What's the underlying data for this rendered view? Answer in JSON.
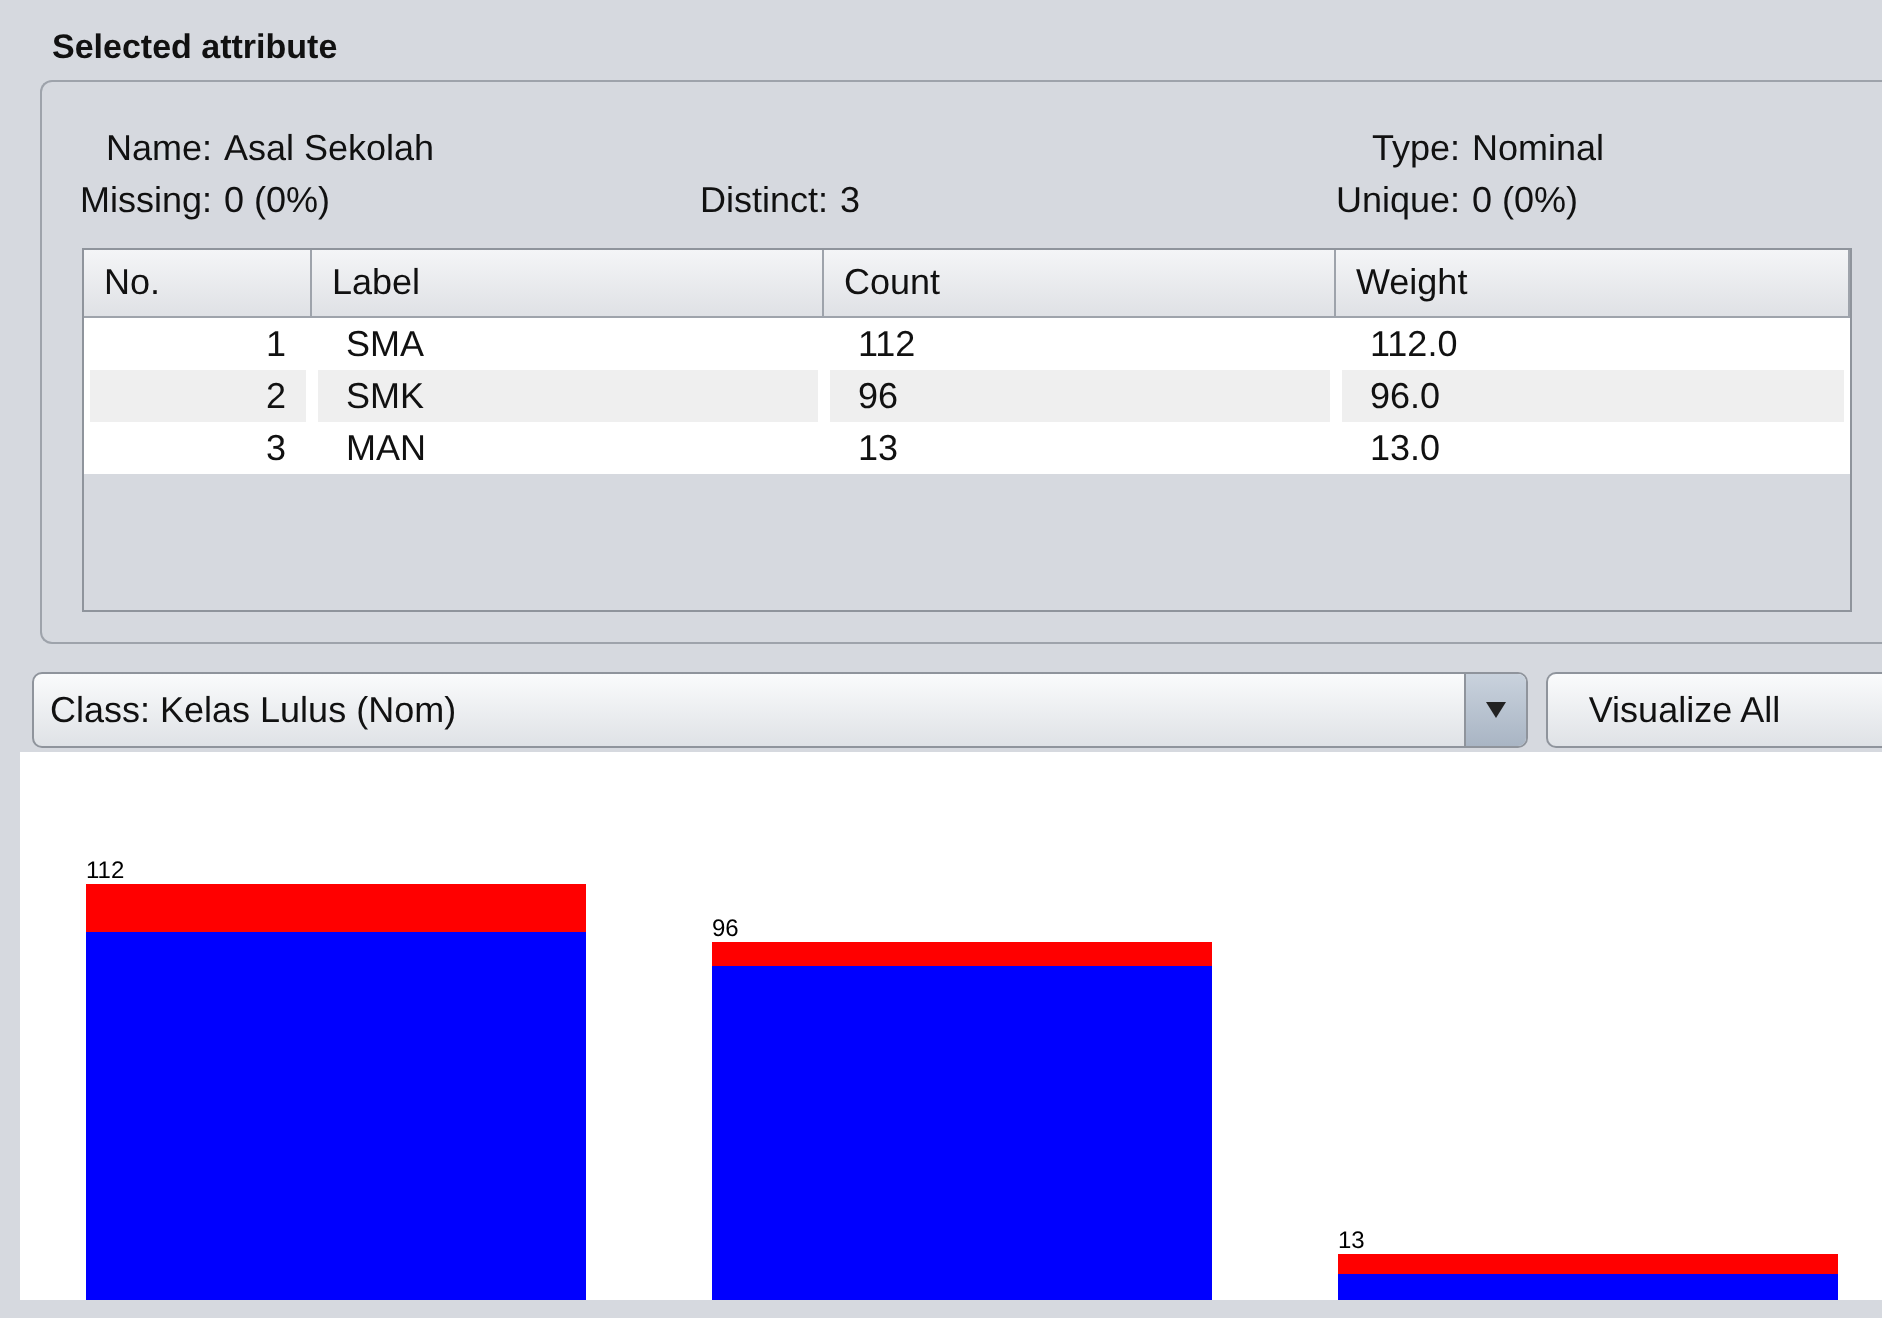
{
  "panel": {
    "title": "Selected attribute",
    "info": [
      {
        "label": "Name:",
        "value": "Asal Sekolah"
      },
      {
        "label": "Type:",
        "value": "Nominal"
      },
      {
        "label": "Missing:",
        "value": "0 (0%)"
      },
      {
        "label": "Distinct:",
        "value": "3"
      },
      {
        "label": "Unique:",
        "value": "0 (0%)"
      }
    ],
    "table": {
      "columns": [
        "No.",
        "Label",
        "Count",
        "Weight"
      ],
      "rows": [
        [
          "1",
          "SMA",
          "112",
          "112.0"
        ],
        [
          "2",
          "SMK",
          "96",
          "96.0"
        ],
        [
          "3",
          "MAN",
          "13",
          "13.0"
        ]
      ]
    }
  },
  "class_select": {
    "value": "Class: Kelas Lulus (Nom)"
  },
  "visualize_button": "Visualize All",
  "histogram": {
    "bar_labels": [
      "112",
      "96",
      "13"
    ]
  }
}
